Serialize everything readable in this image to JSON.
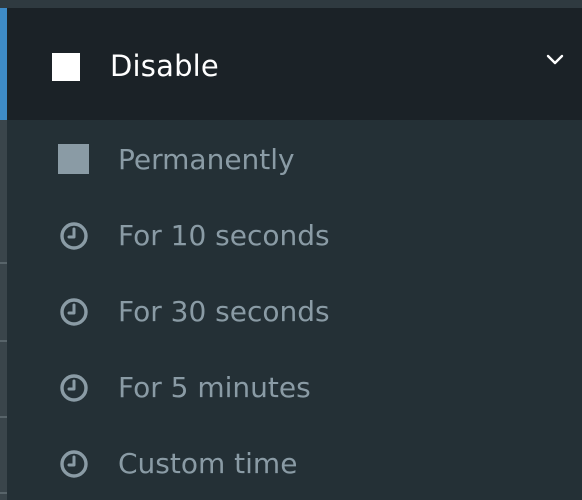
{
  "menu": {
    "header": {
      "label": "Disable",
      "icon": "square-icon",
      "chevron_icon": "chevron-down-icon"
    },
    "items": [
      {
        "label": "Permanently",
        "icon": "square-icon"
      },
      {
        "label": "For 10 seconds",
        "icon": "clock-icon"
      },
      {
        "label": "For 30 seconds",
        "icon": "clock-icon"
      },
      {
        "label": "For 5 minutes",
        "icon": "clock-icon"
      },
      {
        "label": "Custom time",
        "icon": "clock-icon"
      }
    ]
  },
  "colors": {
    "header_bg": "#1b2227",
    "panel_bg": "#243036",
    "accent": "#3e8bc6",
    "item_text": "#8a9ba5",
    "header_text": "#ffffff"
  }
}
